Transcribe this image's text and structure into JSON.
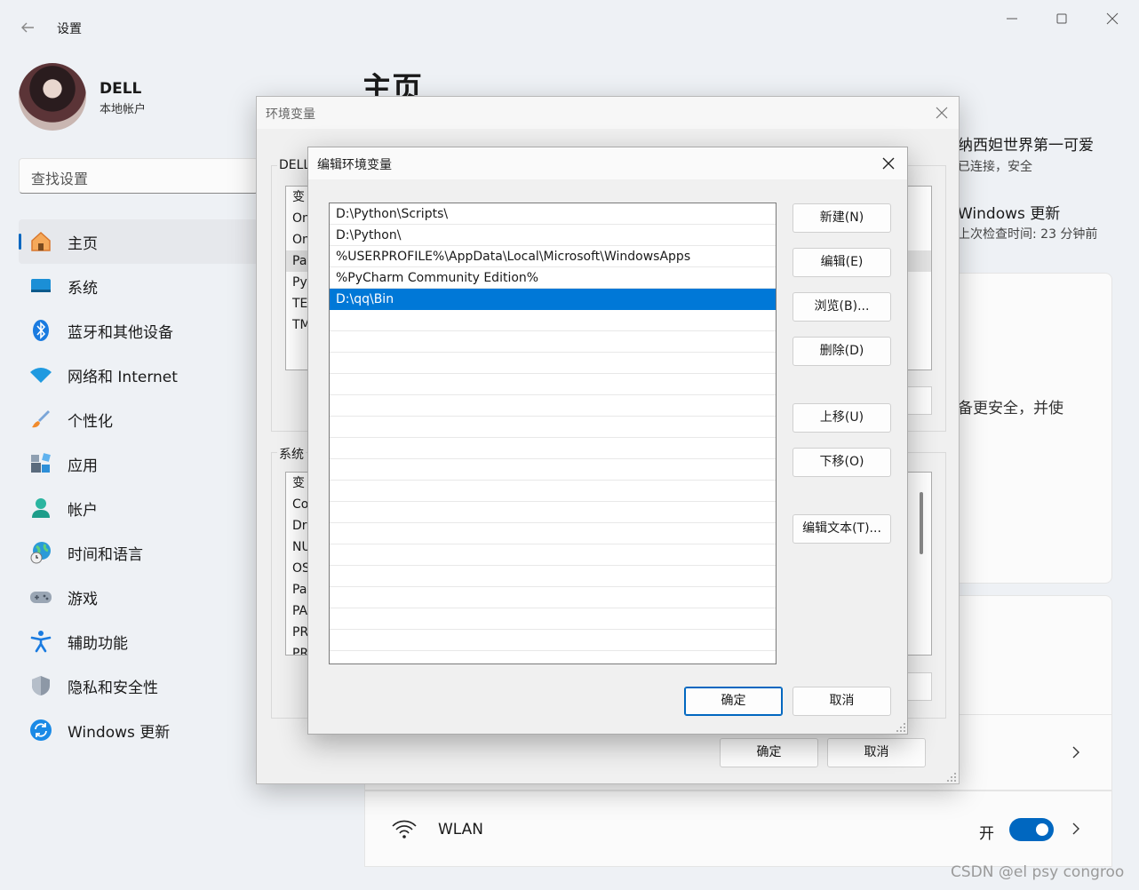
{
  "settings": {
    "app_title": "设置",
    "user": {
      "name": "DELL",
      "account_type": "本地帐户"
    },
    "search_placeholder": "查找设置",
    "nav": [
      {
        "label": "主页",
        "icon": "home-icon",
        "active": true
      },
      {
        "label": "系统",
        "icon": "system-icon"
      },
      {
        "label": "蓝牙和其他设备",
        "icon": "bluetooth-icon"
      },
      {
        "label": "网络和 Internet",
        "icon": "wifi-icon"
      },
      {
        "label": "个性化",
        "icon": "brush-icon"
      },
      {
        "label": "应用",
        "icon": "apps-icon"
      },
      {
        "label": "帐户",
        "icon": "account-icon"
      },
      {
        "label": "时间和语言",
        "icon": "globe-clock-icon"
      },
      {
        "label": "游戏",
        "icon": "gamepad-icon"
      },
      {
        "label": "辅助功能",
        "icon": "accessibility-icon"
      },
      {
        "label": "隐私和安全性",
        "icon": "shield-icon"
      },
      {
        "label": "Windows 更新",
        "icon": "windows-update-icon"
      }
    ],
    "page_title": "主页",
    "wifi_network": "纳西妲世界第一可爱",
    "wifi_status": "已连接，安全",
    "update_title": "Windows 更新",
    "update_status": "上次检查时间: 23 分钟前",
    "card_text": "备更安全，并使",
    "wlan_label": "WLAN",
    "wlan_state": "开",
    "wlan_on": true
  },
  "env_dialog": {
    "title": "环境变量",
    "user_group_label": "DELL",
    "user_list": [
      "变",
      "On",
      "On",
      "Pa",
      "Py",
      "TE",
      "TM"
    ],
    "system_group_label": "系统",
    "system_list": [
      "变",
      "Co",
      "Dr",
      "NU",
      "OS",
      "Pa",
      "PA",
      "PR",
      "PR"
    ],
    "ok_label": "确定",
    "cancel_label": "取消"
  },
  "edit_dialog": {
    "title": "编辑环境变量",
    "paths": [
      "D:\\Python\\Scripts\\",
      "D:\\Python\\",
      "%USERPROFILE%\\AppData\\Local\\Microsoft\\WindowsApps",
      "%PyCharm Community Edition%",
      "D:\\qq\\Bin"
    ],
    "selected_index": 4,
    "buttons": {
      "new": "新建(N)",
      "edit": "编辑(E)",
      "browse": "浏览(B)...",
      "delete": "删除(D)",
      "move_up": "上移(U)",
      "move_down": "下移(O)",
      "edit_text": "编辑文本(T)..."
    },
    "ok_label": "确定",
    "cancel_label": "取消"
  },
  "watermark": "CSDN @el psy congroo",
  "colors": {
    "accent": "#0067c0",
    "selection": "#0078d7"
  }
}
